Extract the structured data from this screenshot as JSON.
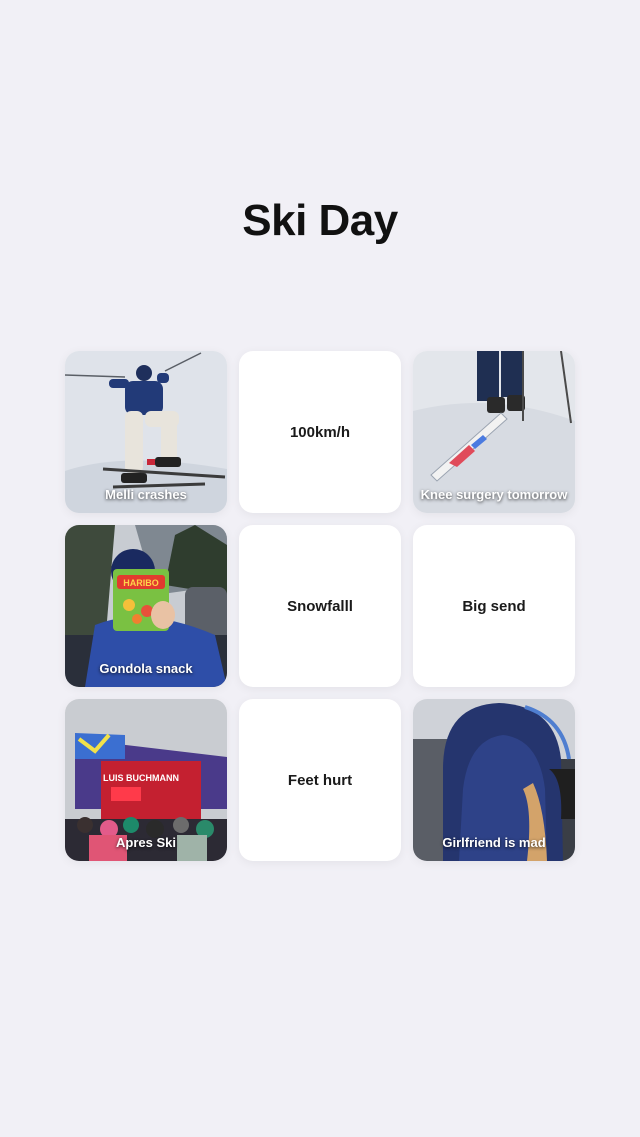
{
  "title": "Ski Day",
  "tiles": [
    {
      "kind": "photo",
      "caption": "Melli crashes",
      "photo_subject": "skier lying in snow"
    },
    {
      "kind": "text",
      "label": "100km/h"
    },
    {
      "kind": "photo",
      "caption": "Knee surgery tomorrow",
      "photo_subject": "skis and poles on snow"
    },
    {
      "kind": "photo",
      "caption": "Gondola snack",
      "photo_subject": "person holding candy bag in gondola"
    },
    {
      "kind": "text",
      "label": "Snowfalll"
    },
    {
      "kind": "text",
      "label": "Big send"
    },
    {
      "kind": "photo",
      "caption": "Apres Ski",
      "photo_subject": "crowd at outdoor stage",
      "photo_sign_text": "LUIS BUCHMANN"
    },
    {
      "kind": "text",
      "label": "Feet hurt"
    },
    {
      "kind": "photo",
      "caption": "Girlfriend is mad",
      "photo_subject": "person in blue hooded jacket"
    }
  ]
}
